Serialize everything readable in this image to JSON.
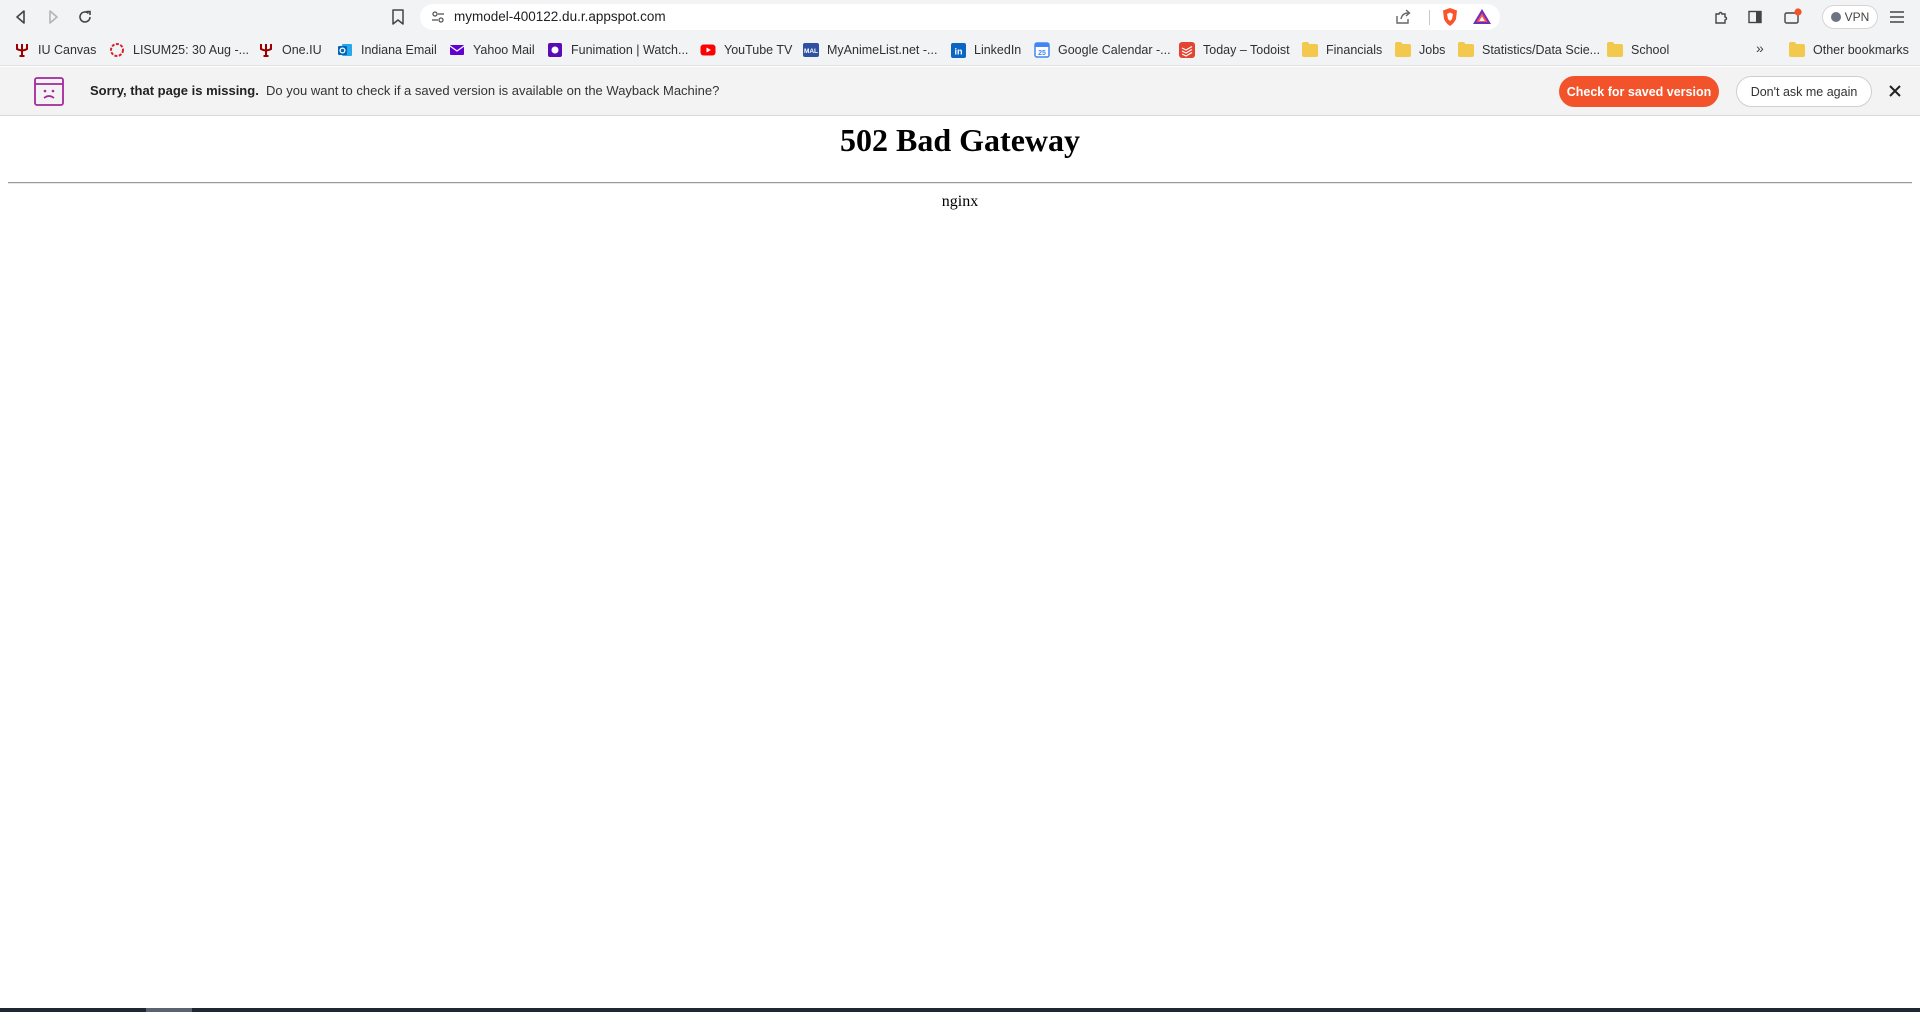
{
  "browser": {
    "url": "mymodel-400122.du.r.appspot.com",
    "vpn_label": "VPN"
  },
  "bookmarks": [
    {
      "label": "IU  Canvas",
      "icon": "iu-trident-icon"
    },
    {
      "label": "LISUM25: 30 Aug -...",
      "icon": "lisum-ring-icon"
    },
    {
      "label": "One.IU",
      "icon": "iu-trident-icon"
    },
    {
      "label": "Indiana Email",
      "icon": "outlook-icon"
    },
    {
      "label": "Yahoo Mail",
      "icon": "yahoo-mail-icon"
    },
    {
      "label": "Funimation | Watch...",
      "icon": "funimation-icon"
    },
    {
      "label": "YouTube TV",
      "icon": "youtube-icon"
    },
    {
      "label": "MyAnimeList.net -...",
      "icon": "mal-icon"
    },
    {
      "label": "LinkedIn",
      "icon": "linkedin-icon"
    },
    {
      "label": "Google Calendar -...",
      "icon": "calendar-icon"
    },
    {
      "label": "Today – Todoist",
      "icon": "todoist-icon"
    },
    {
      "label": "Financials",
      "icon": "folder-icon"
    },
    {
      "label": "Jobs",
      "icon": "folder-icon"
    },
    {
      "label": "Statistics/Data Scie...",
      "icon": "folder-icon"
    },
    {
      "label": "School",
      "icon": "folder-icon"
    }
  ],
  "more_bookmarks": "»",
  "other_bookmarks": "Other bookmarks",
  "infobar": {
    "title": "Sorry, that page is missing.",
    "message": "Do you want to check if a saved version is available on the Wayback Machine?",
    "check_button": "Check for saved version",
    "dont_ask_button": "Don't ask me again",
    "accent_color": "#f2532a"
  },
  "page": {
    "heading": "502 Bad Gateway",
    "server": "nginx"
  }
}
